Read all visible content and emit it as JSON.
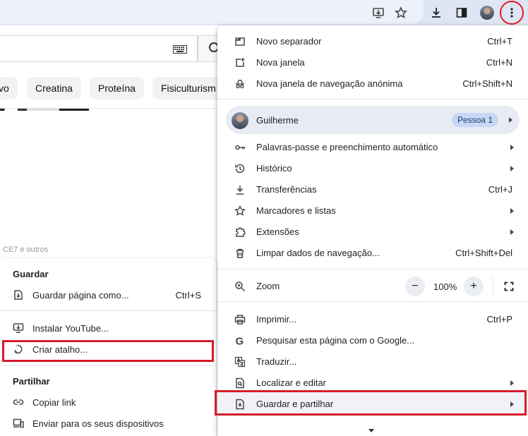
{
  "toolbar": {
    "icons": [
      "install-app-icon",
      "star-icon",
      "download-icon",
      "side-panel-icon",
      "profile-avatar",
      "menu-kebab-icon"
    ]
  },
  "background_page": {
    "chips": [
      "vo",
      "Creatina",
      "Proteína",
      "Fisiculturism"
    ],
    "faint_text": "CE7 e outros"
  },
  "submenu": {
    "heading_save": "Guardar",
    "save_page": {
      "label": "Guardar página como...",
      "shortcut": "Ctrl+S"
    },
    "install": {
      "label": "Instalar YouTube..."
    },
    "shortcut": {
      "label": "Criar atalho..."
    },
    "heading_share": "Partilhar",
    "copy_link": {
      "label": "Copiar link"
    },
    "send_devices": {
      "label": "Enviar para os seus dispositivos"
    }
  },
  "menu": {
    "new_tab": {
      "label": "Novo separador",
      "shortcut": "Ctrl+T"
    },
    "new_window": {
      "label": "Nova janela",
      "shortcut": "Ctrl+N"
    },
    "incognito": {
      "label": "Nova janela de navegação anónima",
      "shortcut": "Ctrl+Shift+N"
    },
    "profile": {
      "name": "Guilherme",
      "badge": "Pessoa 1"
    },
    "passwords": {
      "label": "Palavras-passe e preenchimento automático"
    },
    "history": {
      "label": "Histórico"
    },
    "downloads": {
      "label": "Transferências",
      "shortcut": "Ctrl+J"
    },
    "bookmarks": {
      "label": "Marcadores e listas"
    },
    "extensions": {
      "label": "Extensões"
    },
    "clear_data": {
      "label": "Limpar dados de navegação...",
      "shortcut": "Ctrl+Shift+Del"
    },
    "zoom": {
      "label": "Zoom",
      "minus": "−",
      "value": "100%",
      "plus": "+"
    },
    "print": {
      "label": "Imprimir...",
      "shortcut": "Ctrl+P"
    },
    "google_search": {
      "label": "Pesquisar esta página com o Google..."
    },
    "translate": {
      "label": "Traduzir..."
    },
    "find_edit": {
      "label": "Localizar e editar"
    },
    "save_share": {
      "label": "Guardar e partilhar"
    }
  },
  "colors": {
    "highlight_red": "#d71c2a",
    "profile_row_bg": "#e8ebf3",
    "badge_bg": "#c7d7f5"
  }
}
